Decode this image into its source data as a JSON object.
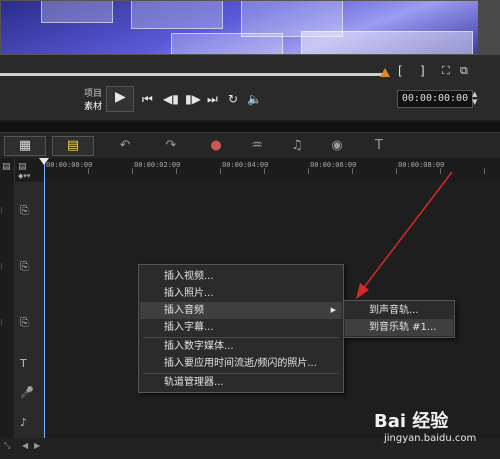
{
  "player": {
    "mode_project": "项目",
    "mode_clip": "素材",
    "timecode": "00:00:00:00",
    "mark_in": "[",
    "mark_out": "]"
  },
  "ruler": {
    "labels": [
      "00:00:00:00",
      "00:00:02:00",
      "00:00:04:00",
      "00:00:06:00",
      "00:00:08:00"
    ]
  },
  "context_menu": {
    "items": [
      {
        "label": "插入视频..."
      },
      {
        "label": "插入照片..."
      },
      {
        "label": "插入音频"
      },
      {
        "label": "插入字幕..."
      },
      {
        "label": "插入数字媒体..."
      },
      {
        "label": "插入要应用时间流逝/频闪的照片..."
      },
      {
        "label": "轨道管理器..."
      }
    ],
    "submenu_arrow": "▶"
  },
  "submenu": {
    "items": [
      {
        "label": "到声音轨..."
      },
      {
        "label": "到音乐轨 #1..."
      }
    ]
  },
  "watermark": {
    "logo": "Bai 经验",
    "url": "jingyan.baidu.com"
  },
  "colors": {
    "accent_arrow": "#d42a2a",
    "scrub_handle": "#e0882a",
    "playhead": "#7ab0ff"
  }
}
